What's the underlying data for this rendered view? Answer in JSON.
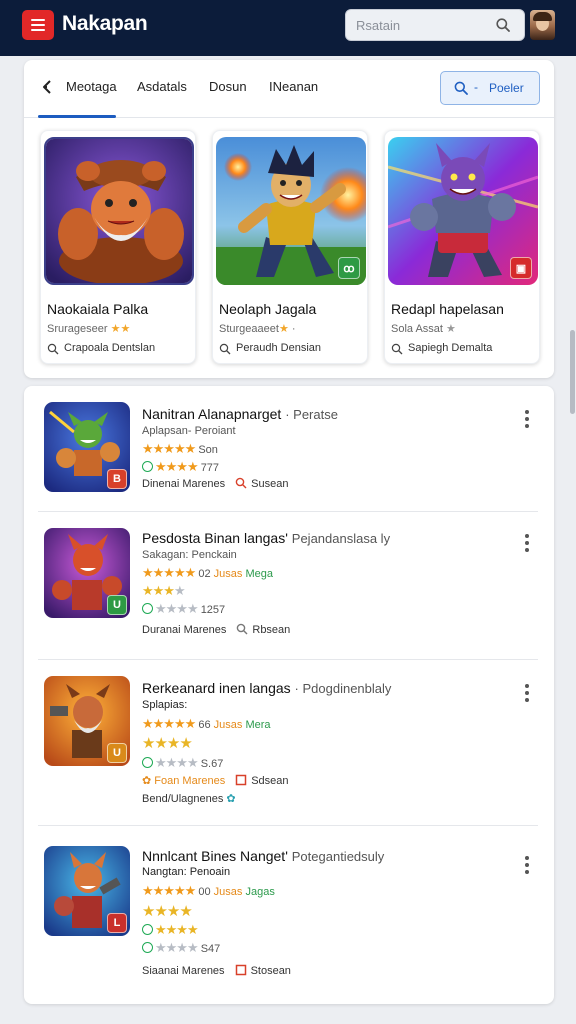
{
  "header": {
    "app_title": "Nakapan",
    "search_placeholder": "Rsatain",
    "bg_color": "#0c1c3a",
    "menu_color": "#e22828"
  },
  "tabs": {
    "items": [
      "Meotaga",
      "Asdatals",
      "Dosun",
      "INeanan"
    ],
    "active_index": 0,
    "filter_dash": "-",
    "filter_label": "Poeler"
  },
  "featured": [
    {
      "title": "Naokaiala Palka",
      "meta": "Srurageseer",
      "stars": "★★",
      "developer": "Crapoala Dentslan",
      "art_icon": "bearded-cowboy-art",
      "badge": ""
    },
    {
      "title": "Neolaph Jagala",
      "meta": "Sturgeaaeet",
      "stars": "★",
      "extra": "·",
      "developer": "Peraudh Densian",
      "art_icon": "fire-warrior-art",
      "badge": "ꝏ",
      "badge_color": "#2e9a44"
    },
    {
      "title": "Redapl hapelasan",
      "meta": "Sola Assat",
      "stars": "★",
      "developer": "Sapiegh Demalta",
      "art_icon": "robot-wolf-art",
      "badge": "▣",
      "badge_color": "#d52b2b"
    }
  ],
  "list": [
    {
      "title": "Nanitran Alanapnarget",
      "tag": "· Peratse",
      "subtitle": "Aplapsan- Peroiant",
      "rating_text": "Son",
      "line2_text": "777",
      "dev": "Dinenai Marenes",
      "stat": "Susean",
      "badge": "B",
      "badge_color": "#d8402a",
      "art_icon": "goblin-warrior-art"
    },
    {
      "title": "Pesdosta Binan langas'",
      "tag": "Pejandanslasa ly",
      "subtitle": "Sakagan: Penckain",
      "rating_text": "02",
      "rating_orange": "Jusas",
      "rating_green": "Mega",
      "line3_text": "1257",
      "dev": "Duranai Marenes",
      "stat": "Rbsean",
      "badge": "U",
      "badge_color": "#2e9a44",
      "art_icon": "red-imp-art"
    },
    {
      "title": "Rerkeanard inen langas",
      "tag": "· Pdogdinenblaly",
      "subtitle": "Splapias:",
      "rating_text": "66",
      "rating_orange": "Jusas",
      "rating_green": "Mera",
      "line3_text": "S.67",
      "dev": "Foan Marenes",
      "stat": "Sdsean",
      "line5": "Bend/Ulagnenes",
      "badge": "U",
      "badge_color": "#d98a1a",
      "art_icon": "bearded-warrior-art"
    },
    {
      "title": "Nnnlcant Bines Nanget'",
      "tag": "Potegantiedsuly",
      "subtitle": "Nangtan: Penoain",
      "rating_text": "00",
      "rating_orange": "Jusas",
      "rating_green": "Jagas",
      "line3_text": "S47",
      "dev": "Siaanai Marenes",
      "stat": "Stosean",
      "badge": "L",
      "badge_color": "#c9302c",
      "art_icon": "armored-fox-art"
    }
  ]
}
